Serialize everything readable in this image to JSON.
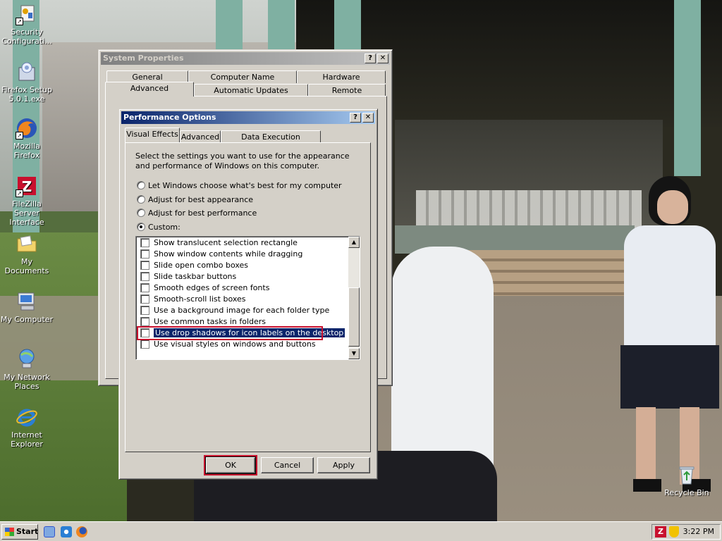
{
  "desktop_icons": [
    {
      "name": "security-config",
      "label": "Security Configurati..."
    },
    {
      "name": "firefox-setup",
      "label": "Firefox Setup 5.0.1.exe"
    },
    {
      "name": "mozilla-firefox",
      "label": "Mozilla Firefox"
    },
    {
      "name": "filezilla-server",
      "label": "FileZilla Server Interface"
    },
    {
      "name": "my-documents",
      "label": "My Documents"
    },
    {
      "name": "my-computer",
      "label": "My Computer"
    },
    {
      "name": "my-network-places",
      "label": "My Network Places"
    },
    {
      "name": "internet-explorer",
      "label": "Internet Explorer"
    },
    {
      "name": "recycle-bin",
      "label": "Recycle Bin"
    }
  ],
  "system_properties": {
    "title": "System Properties",
    "help_btn": "?",
    "close_btn": "✕",
    "tabs_back": [
      "General",
      "Computer Name",
      "Hardware"
    ],
    "tabs_front": [
      "Advanced",
      "Automatic Updates",
      "Remote"
    ]
  },
  "performance_options": {
    "title": "Performance Options",
    "help_btn": "?",
    "close_btn": "✕",
    "tabs": [
      "Visual Effects",
      "Advanced",
      "Data Execution Prevention"
    ],
    "description": "Select the settings you want to use for the appearance and performance of Windows on this computer.",
    "radios": [
      {
        "label": "Let Windows choose what's best for my computer",
        "selected": false
      },
      {
        "label": "Adjust for best appearance",
        "selected": false
      },
      {
        "label": "Adjust for best performance",
        "selected": false
      },
      {
        "label": "Custom:",
        "selected": true
      }
    ],
    "effects": [
      {
        "label": "Show translucent selection rectangle",
        "checked": false,
        "selected": false
      },
      {
        "label": "Show window contents while dragging",
        "checked": false,
        "selected": false
      },
      {
        "label": "Slide open combo boxes",
        "checked": false,
        "selected": false
      },
      {
        "label": "Slide taskbar buttons",
        "checked": false,
        "selected": false
      },
      {
        "label": "Smooth edges of screen fonts",
        "checked": false,
        "selected": false
      },
      {
        "label": "Smooth-scroll list boxes",
        "checked": false,
        "selected": false
      },
      {
        "label": "Use a background image for each folder type",
        "checked": false,
        "selected": false
      },
      {
        "label": "Use common tasks in folders",
        "checked": false,
        "selected": false
      },
      {
        "label": "Use drop shadows for icon labels on the desktop",
        "checked": false,
        "selected": true
      },
      {
        "label": "Use visual styles on windows and buttons",
        "checked": false,
        "selected": false
      }
    ],
    "buttons": {
      "ok": "OK",
      "cancel": "Cancel",
      "apply": "Apply"
    }
  },
  "taskbar": {
    "start_label": "Start",
    "clock": "3:22 PM"
  },
  "colors": {
    "title_active": "#0a246a",
    "highlight_box": "#c8102e"
  }
}
